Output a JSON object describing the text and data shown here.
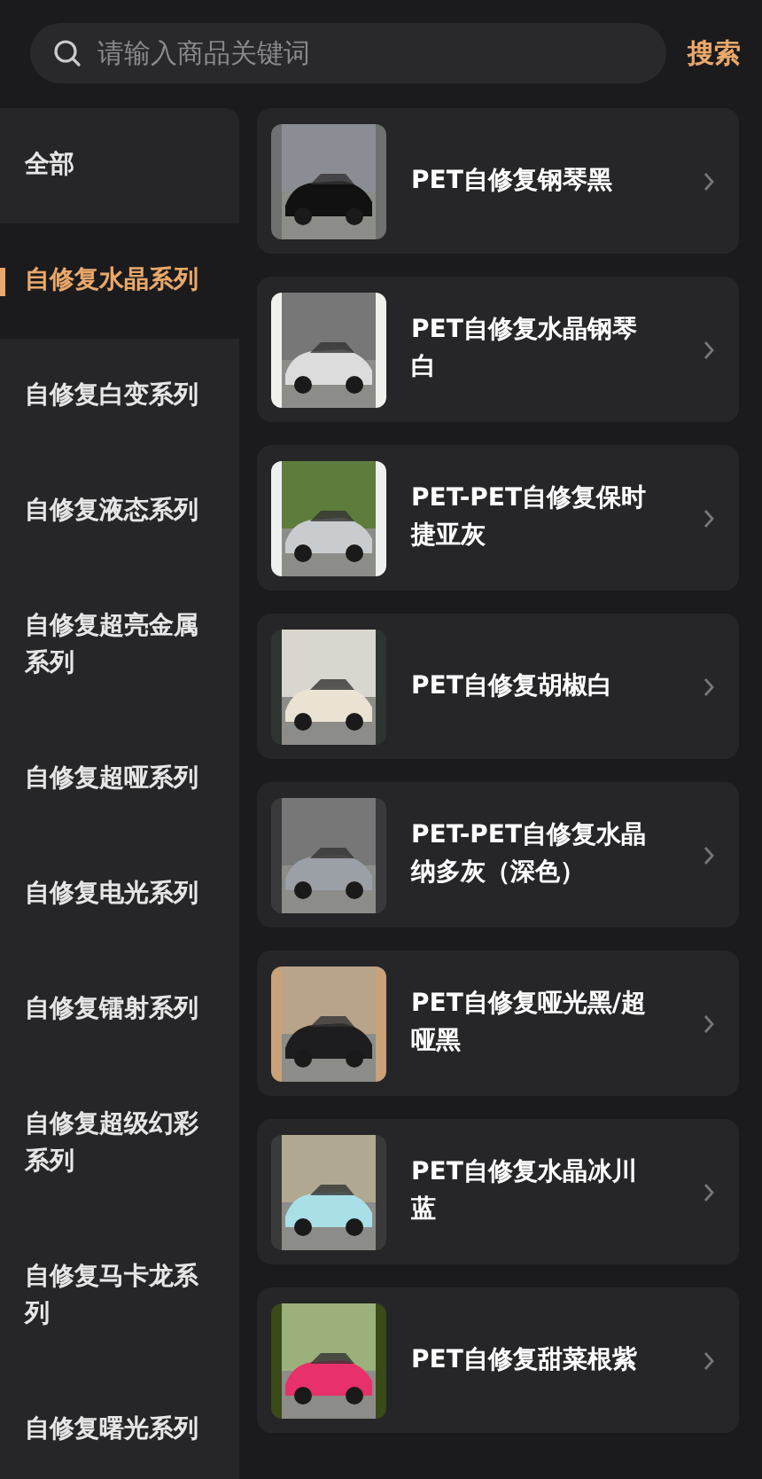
{
  "search": {
    "placeholder": "请输入商品关键词",
    "button": "搜索"
  },
  "categories": [
    {
      "label": "全部",
      "selected": false
    },
    {
      "label": "自修复水晶系列",
      "selected": true
    },
    {
      "label": "自修复白变系列",
      "selected": false
    },
    {
      "label": "自修复液态系列",
      "selected": false
    },
    {
      "label": "自修复超亮金属系列",
      "selected": false
    },
    {
      "label": "自修复超哑系列",
      "selected": false
    },
    {
      "label": "自修复电光系列",
      "selected": false
    },
    {
      "label": "自修复镭射系列",
      "selected": false
    },
    {
      "label": "自修复超级幻彩系列",
      "selected": false
    },
    {
      "label": "自修复马卡龙系列",
      "selected": false
    },
    {
      "label": "自修复曙光系列",
      "selected": false
    }
  ],
  "products": [
    {
      "name": "PET自修复钢琴黑"
    },
    {
      "name": "PET自修复水晶钢琴白"
    },
    {
      "name": "PET-PET自修复保时捷亚灰"
    },
    {
      "name": "PET自修复胡椒白"
    },
    {
      "name": "PET-PET自修复水晶纳多灰（深色）"
    },
    {
      "name": "PET自修复哑光黑/超哑黑"
    },
    {
      "name": "PET自修复水晶冰川蓝"
    },
    {
      "name": "PET自修复甜菜根紫"
    }
  ]
}
